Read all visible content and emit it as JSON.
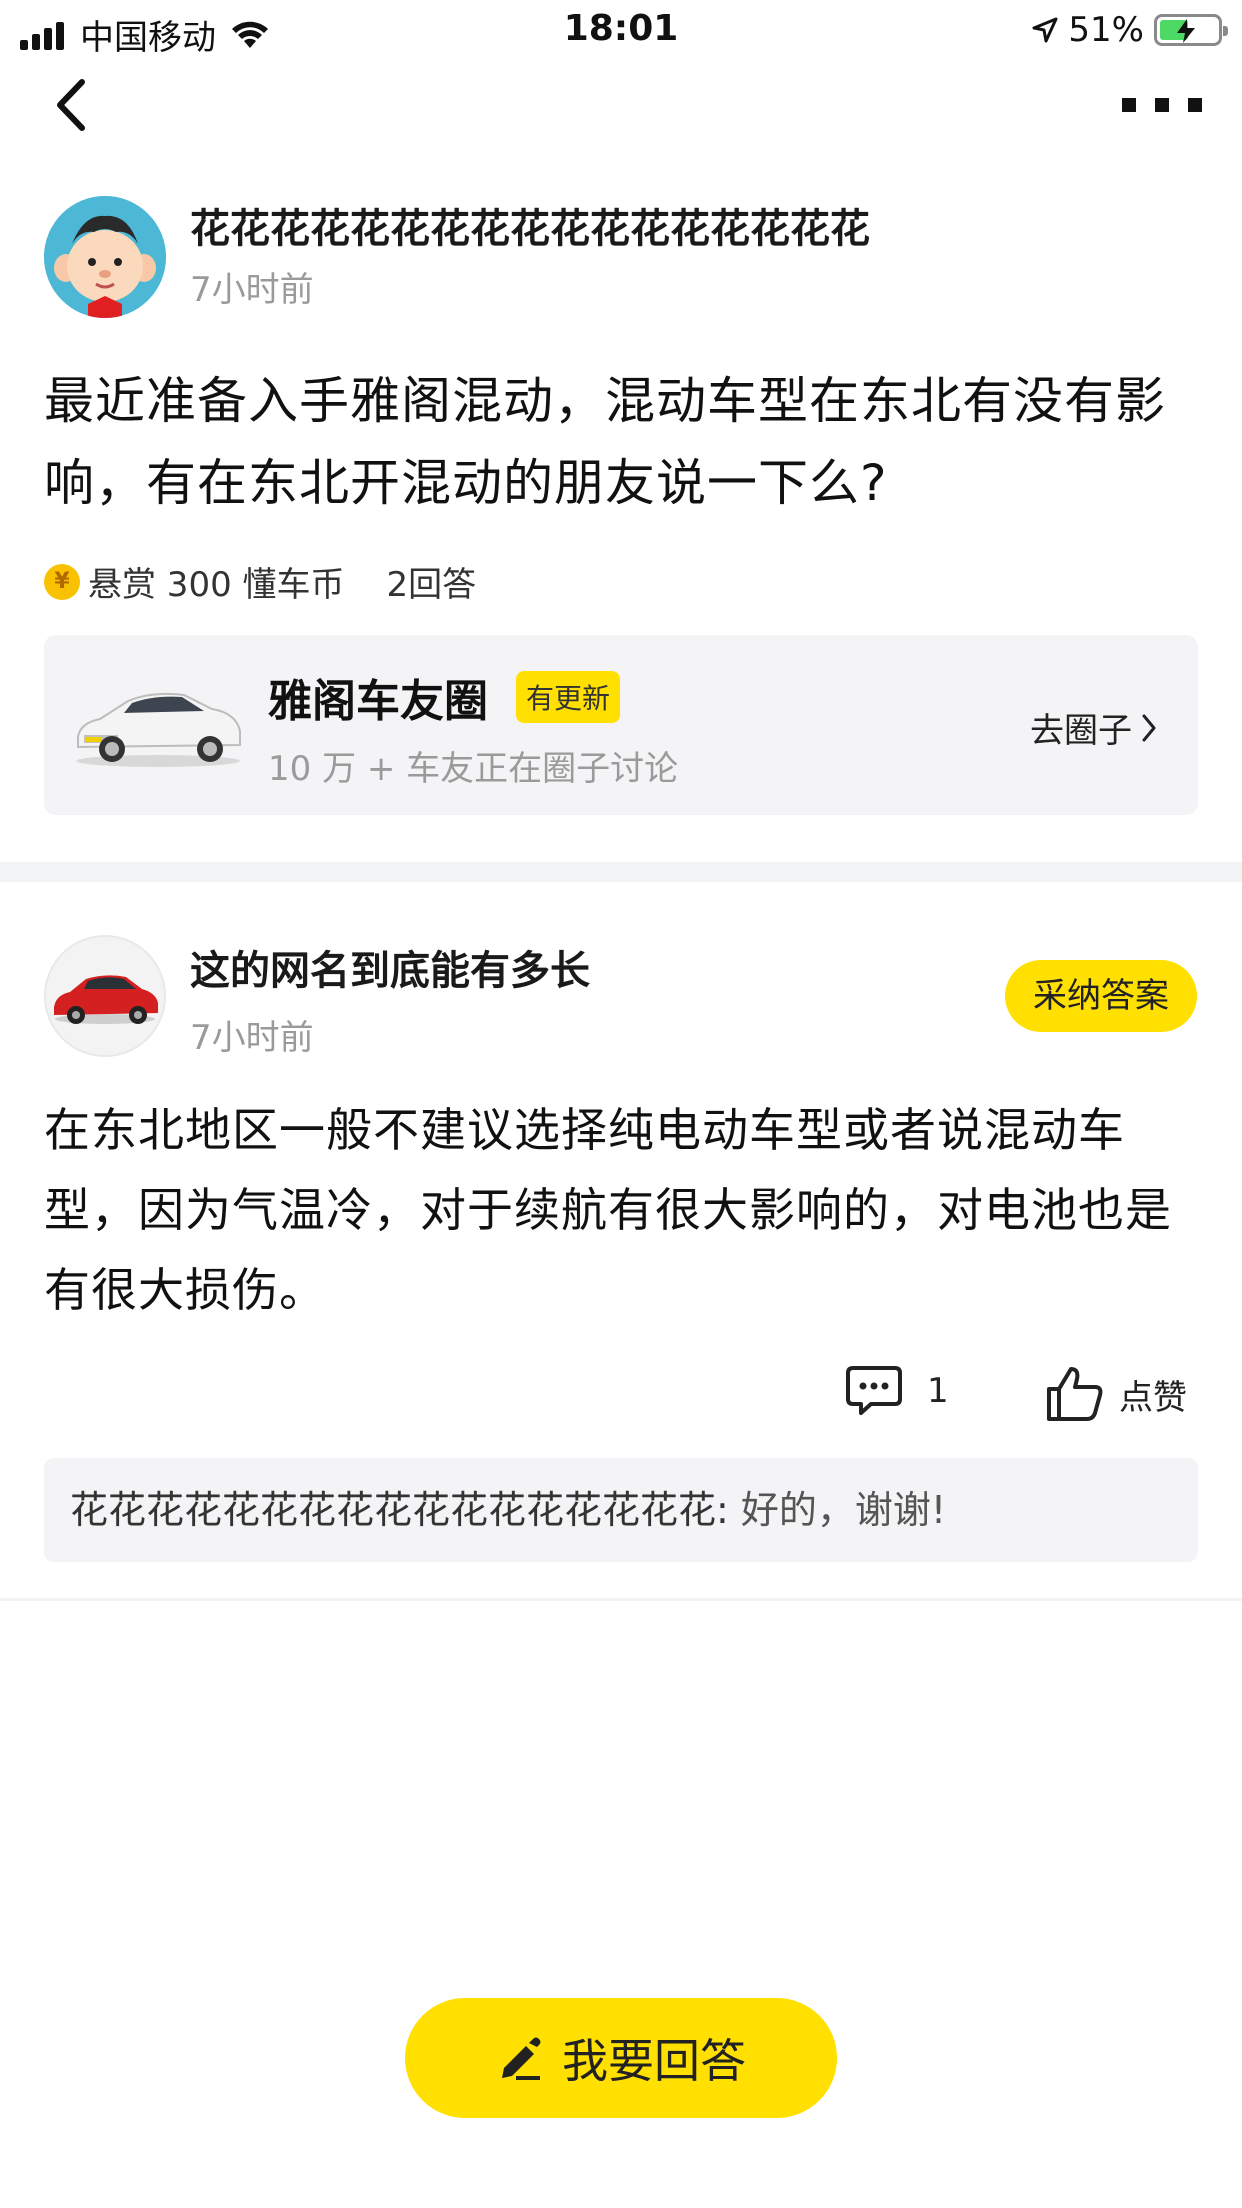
{
  "status_bar": {
    "carrier": "中国移动",
    "time": "18:01",
    "battery": "51%",
    "battery_level": 0.51
  },
  "question": {
    "username": "花花花花花花花花花花花花花花花花花",
    "time_ago": "7小时前",
    "title": "最近准备入手雅阁混动，混动车型在东北有没有影响，有在东北开混动的朋友说一下么?",
    "reward": "悬赏 300 懂车币",
    "answer_count": "2回答",
    "coin_glyph": "¥"
  },
  "circle": {
    "name": "雅阁车友圈",
    "badge": "有更新",
    "subtitle": "10 万 + 车友正在圈子讨论",
    "link": "去圈子"
  },
  "answer": {
    "username": "这的网名到底能有多长",
    "time_ago": "7小时前",
    "accept_label": "采纳答案",
    "body": "在东北地区一般不建议选择纯电动车型或者说混动车型，因为气温冷，对于续航有很大影响的，对电池也是有很大损伤。",
    "comment_count": "1",
    "like_label": "点赞",
    "reply": {
      "user": "花花花花花花花花花花花花花花花花花:",
      "text": "好的，谢谢!"
    }
  },
  "bottom": {
    "answer_button": "我要回答"
  },
  "colors": {
    "accent": "#ffe000",
    "card_bg": "#f4f4f6",
    "muted_text": "#9a9a9a"
  }
}
